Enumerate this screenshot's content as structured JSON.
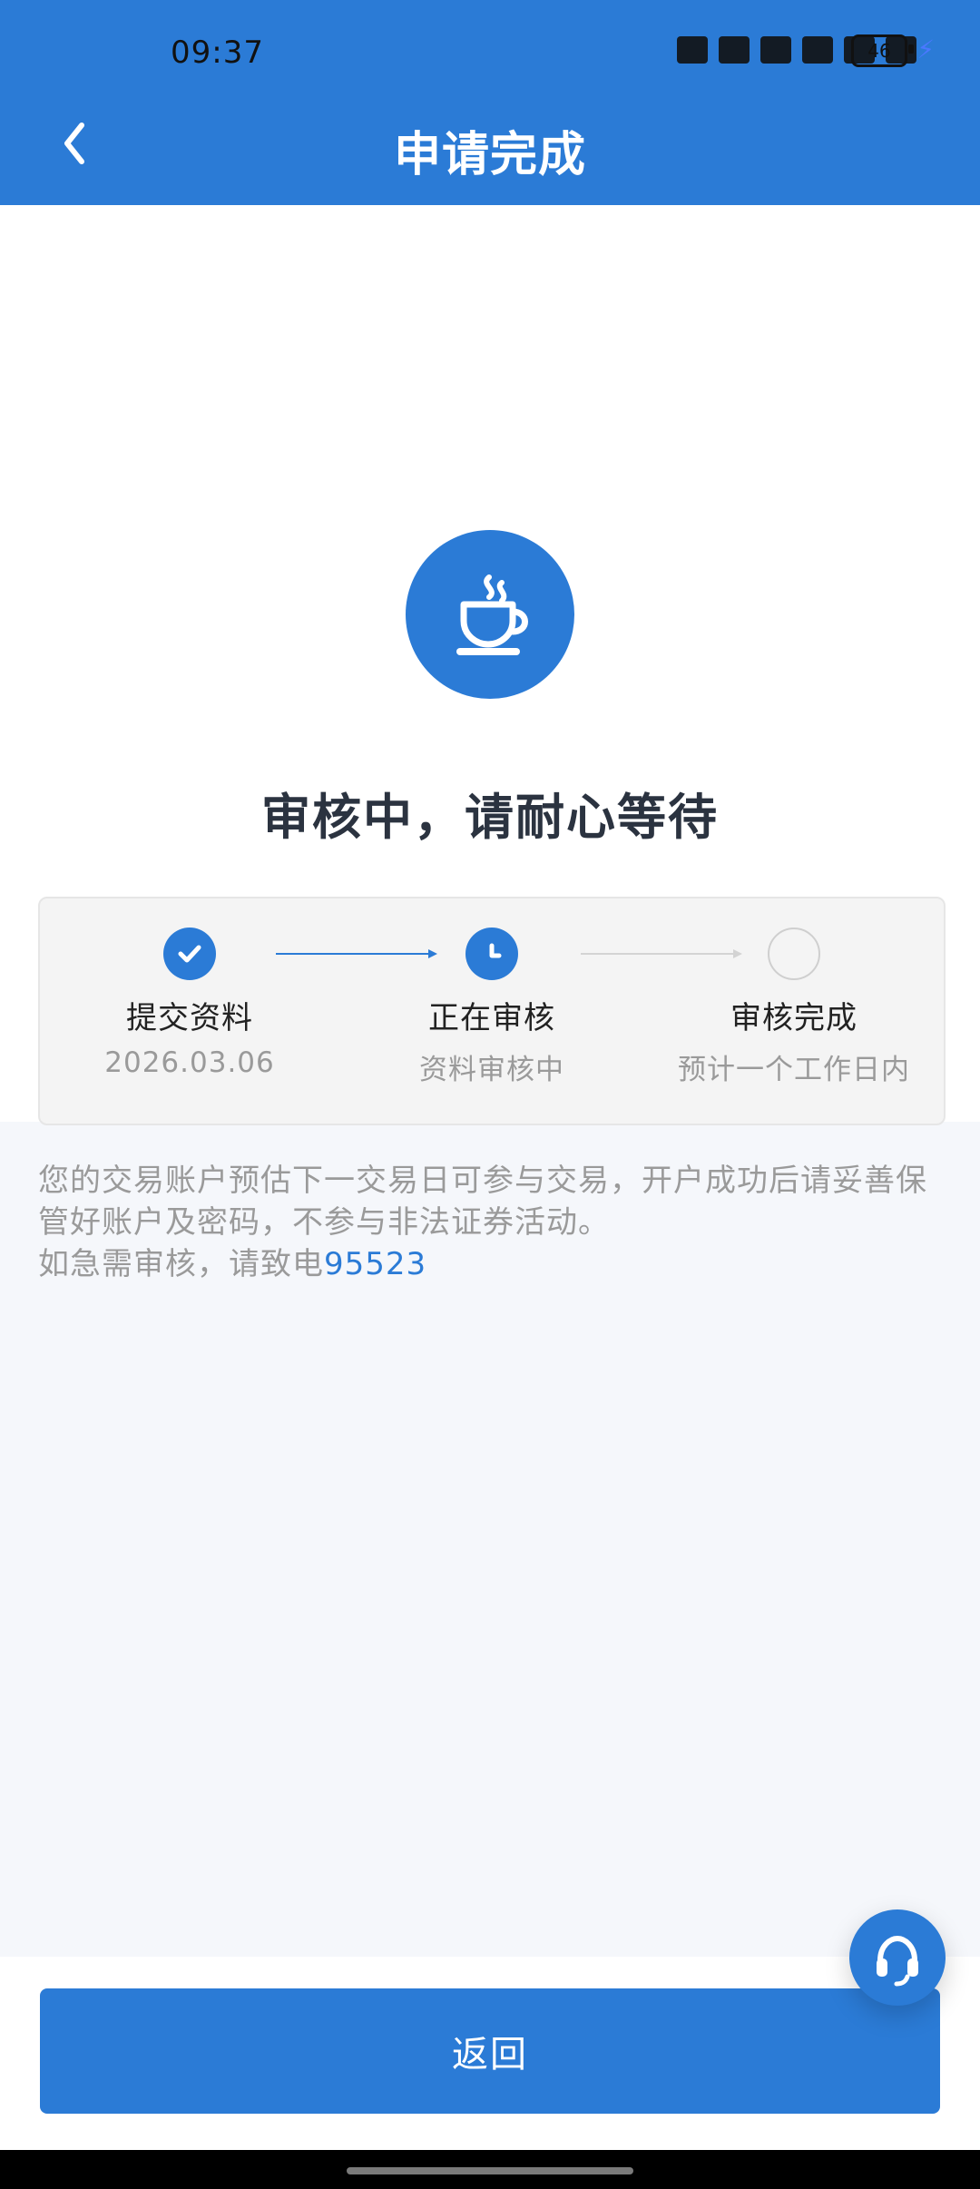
{
  "status_bar": {
    "time": "09:37",
    "battery_level": "46"
  },
  "header": {
    "title": "申请完成",
    "back_icon": "chevron-left-icon"
  },
  "hero": {
    "icon": "coffee-cup-icon",
    "status_text": "审核中，请耐心等待"
  },
  "steps": [
    {
      "label": "提交资料",
      "sub": "2026.03.06",
      "state": "done"
    },
    {
      "label": "正在审核",
      "sub": "资料审核中",
      "state": "current"
    },
    {
      "label": "审核完成",
      "sub": "预计一个工作日内",
      "state": "todo"
    }
  ],
  "notice": {
    "line1": "您的交易账户预估下一交易日可参与交易，开户成功后请妥善保管好账户及密码，不参与非法证券活动。",
    "line2_prefix": "如急需审核，请致电",
    "phone": "95523"
  },
  "floating": {
    "support_icon": "headset-icon"
  },
  "footer": {
    "return_label": "返回"
  },
  "colors": {
    "primary": "#2b7bd6",
    "text_dark": "#2b3340",
    "text_muted": "#9a9a9a",
    "page_bg": "#f5f7fb"
  }
}
